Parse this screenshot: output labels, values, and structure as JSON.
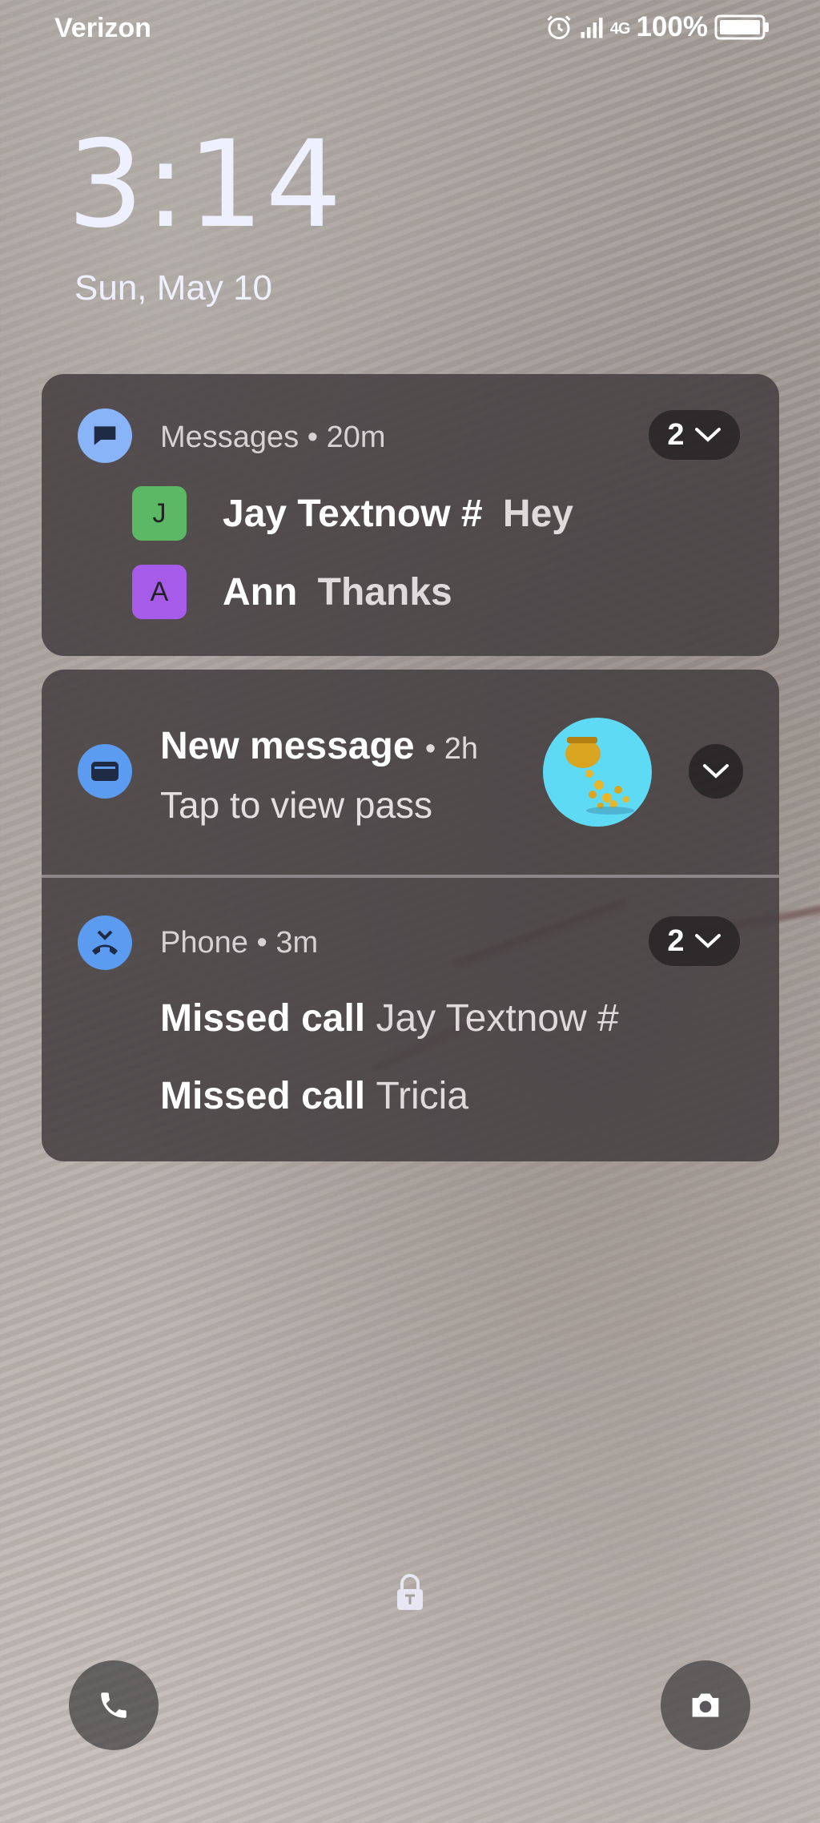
{
  "status_bar": {
    "carrier": "Verizon",
    "network": "4G",
    "battery_percent": "100%"
  },
  "lockscreen": {
    "time": "3:14",
    "date": "Sun, May 10"
  },
  "notifications": {
    "messages": {
      "app": "Messages",
      "time": "20m",
      "count": "2",
      "threads": [
        {
          "initial": "J",
          "sender": "Jay Textnow #",
          "text": "Hey",
          "color": "#5cb865"
        },
        {
          "initial": "A",
          "sender": "Ann",
          "text": "Thanks",
          "color": "#a65ce8"
        }
      ]
    },
    "new_message": {
      "title": "New message",
      "time": "2h",
      "body": "Tap to view pass"
    },
    "phone": {
      "app": "Phone",
      "time": "3m",
      "count": "2",
      "calls": [
        {
          "label": "Missed call",
          "name": "Jay Textnow #"
        },
        {
          "label": "Missed call",
          "name": "Tricia"
        }
      ]
    }
  },
  "shortcuts": {
    "left": "phone-icon",
    "right": "camera-icon"
  },
  "accent_colors": {
    "messages_icon": "#8ab4f8",
    "wallet_icon": "#5b9cf0",
    "phone_icon": "#5b9cf0",
    "thumbnail_bg": "#5fdaf5"
  }
}
